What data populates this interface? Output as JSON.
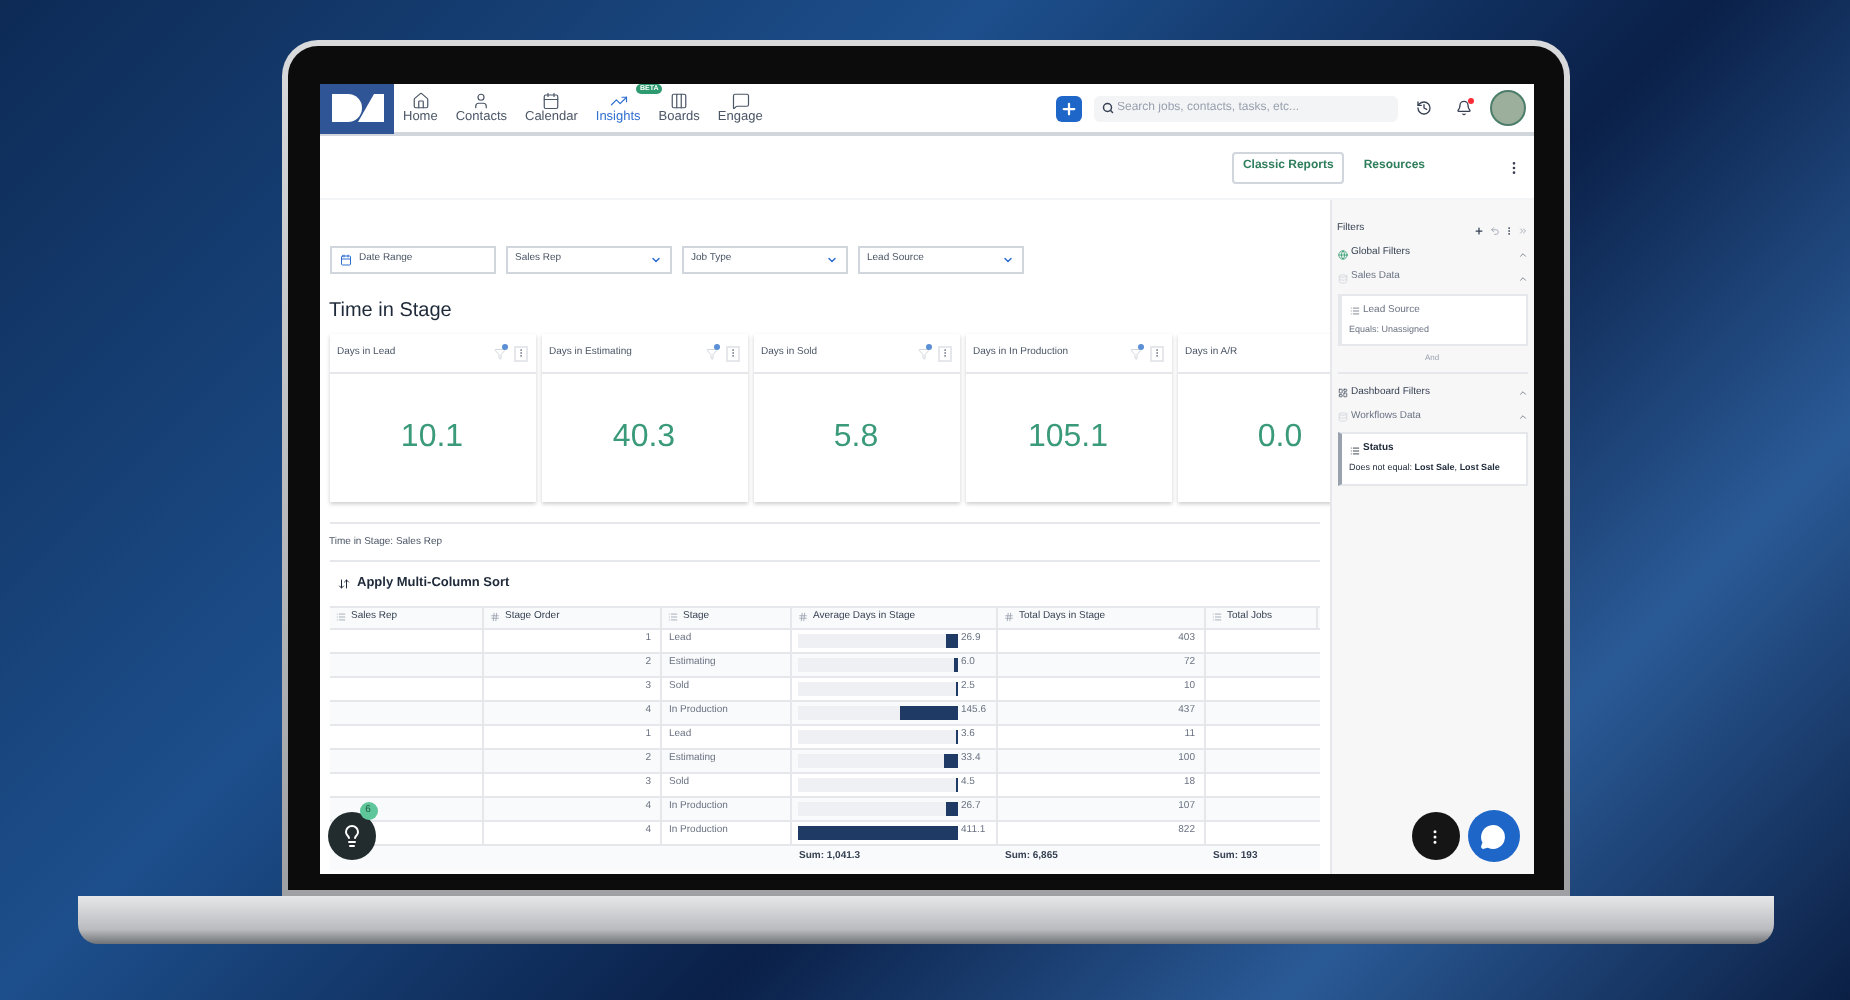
{
  "nav": {
    "items": [
      {
        "label": "Home",
        "selected": false
      },
      {
        "label": "Contacts",
        "selected": false
      },
      {
        "label": "Calendar",
        "selected": false
      },
      {
        "label": "Insights",
        "selected": true,
        "badge": "BETA"
      },
      {
        "label": "Boards",
        "selected": false
      },
      {
        "label": "Engage",
        "selected": false
      }
    ],
    "search": {
      "placeholder": "Search jobs, contacts, tasks, etc..."
    },
    "notification_unread": true
  },
  "toolbar": {
    "buttons": [
      "Classic Reports"
    ],
    "links": [
      "Resources"
    ]
  },
  "filters": [
    {
      "label": "Date Range",
      "kind": "date"
    },
    {
      "label": "Sales Rep",
      "kind": "select"
    },
    {
      "label": "Job Type",
      "kind": "select"
    },
    {
      "label": "Lead Source",
      "kind": "select"
    }
  ],
  "section_title": "Time in Stage",
  "cards": [
    {
      "title": "Days in Lead",
      "value": "10.1",
      "filtered": true
    },
    {
      "title": "Days in Estimating",
      "value": "40.3",
      "filtered": true
    },
    {
      "title": "Days in Sold",
      "value": "5.8",
      "filtered": true
    },
    {
      "title": "Days in In Production",
      "value": "105.1",
      "filtered": true
    },
    {
      "title": "Days in A/R",
      "value": "0.0"
    }
  ],
  "table_title": "Time in Stage: Sales Rep",
  "sort_button": "Apply Multi-Column Sort",
  "table": {
    "columns": [
      "Sales Rep",
      "Stage Order",
      "Stage",
      "Average Days in Stage",
      "Total Days in Stage",
      "Total Jobs"
    ],
    "rows": [
      {
        "order": "1",
        "stage": "Lead",
        "avg": "26.9",
        "level": 0.065,
        "total": "403"
      },
      {
        "order": "2",
        "stage": "Estimating",
        "avg": "6.0",
        "level": 0.015,
        "total": "72"
      },
      {
        "order": "3",
        "stage": "Sold",
        "avg": "2.5",
        "level": 0.006,
        "total": "10"
      },
      {
        "order": "4",
        "stage": "In Production",
        "avg": "145.6",
        "level": 0.354,
        "total": "437"
      },
      {
        "order": "1",
        "stage": "Lead",
        "avg": "3.6",
        "level": 0.009,
        "total": "11"
      },
      {
        "order": "2",
        "stage": "Estimating",
        "avg": "33.4",
        "level": 0.081,
        "total": "100"
      },
      {
        "order": "3",
        "stage": "Sold",
        "avg": "4.5",
        "level": 0.011,
        "total": "18"
      },
      {
        "order": "4",
        "stage": "In Production",
        "avg": "26.7",
        "level": 0.065,
        "total": "107"
      },
      {
        "order": "4",
        "stage": "In Production",
        "avg": "411.1",
        "level": 1.0,
        "total": "822"
      }
    ],
    "sums": [
      "Sum: 1,041.3",
      "Sum: 6,865",
      "Sum: 193"
    ]
  },
  "filter_panel": {
    "title": "Filters",
    "groups": [
      {
        "title": "Global Filters",
        "source": "Sales Data",
        "filter": {
          "name": "Lead Source",
          "condition": "Equals: Unassigned",
          "disabled": true
        }
      },
      {
        "title": "Dashboard Filters",
        "source": "Workflows Data",
        "filter": {
          "name": "Status",
          "condition": "Does not equal: **Lost Sale**, **Lost Sale**",
          "disabled": false
        }
      }
    ],
    "joiner": "And"
  },
  "help_badge": "6"
}
